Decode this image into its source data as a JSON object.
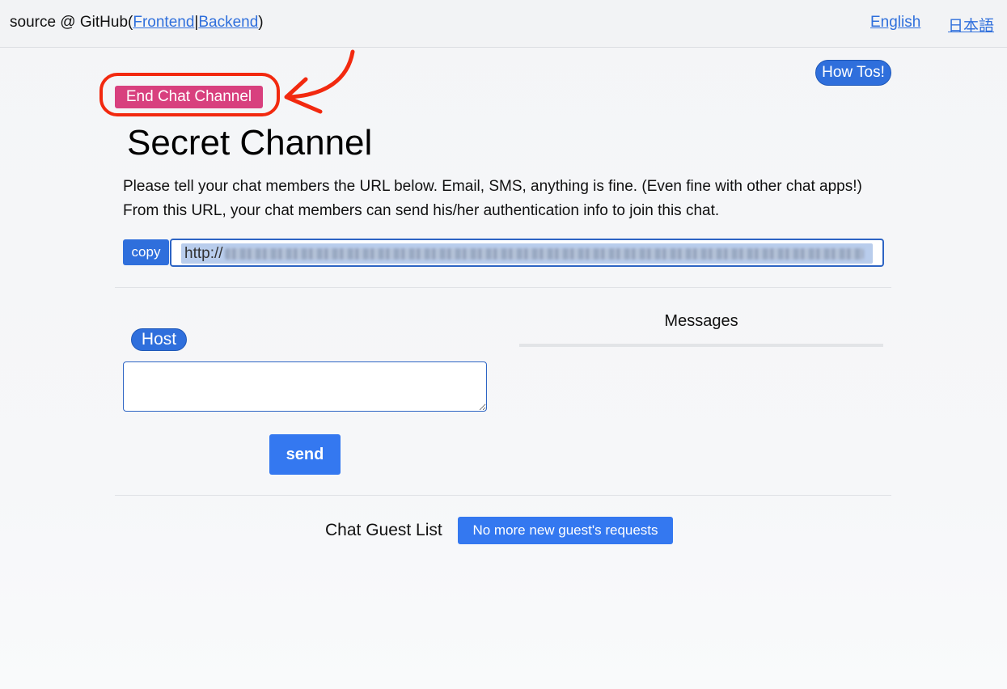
{
  "header": {
    "source_prefix": "source @ GitHub(",
    "frontend_link": "Frontend",
    "separator": "|",
    "backend_link": "Backend",
    "source_suffix": ")",
    "lang_english": "English",
    "lang_japanese": "日本語"
  },
  "actions": {
    "how_tos": "How Tos!",
    "end_chat_channel": "End Chat Channel"
  },
  "channel": {
    "title": "Secret Channel",
    "instructions": "Please tell your chat members the URL below. Email, SMS, anything is fine. (Even fine with other chat apps!) From this URL, your chat members can send his/her authentication info to join this chat.",
    "copy_label": "copy",
    "url_visible_prefix": "http://"
  },
  "chat": {
    "host_badge": "Host",
    "message_value": "",
    "send_label": "send",
    "messages_heading": "Messages"
  },
  "guests": {
    "label": "Chat Guest List",
    "no_more_requests": "No more new guest's requests"
  },
  "colors": {
    "primary": "#2f6fdc",
    "danger_pink": "#d8407e",
    "annotation_red": "#f2290f"
  }
}
